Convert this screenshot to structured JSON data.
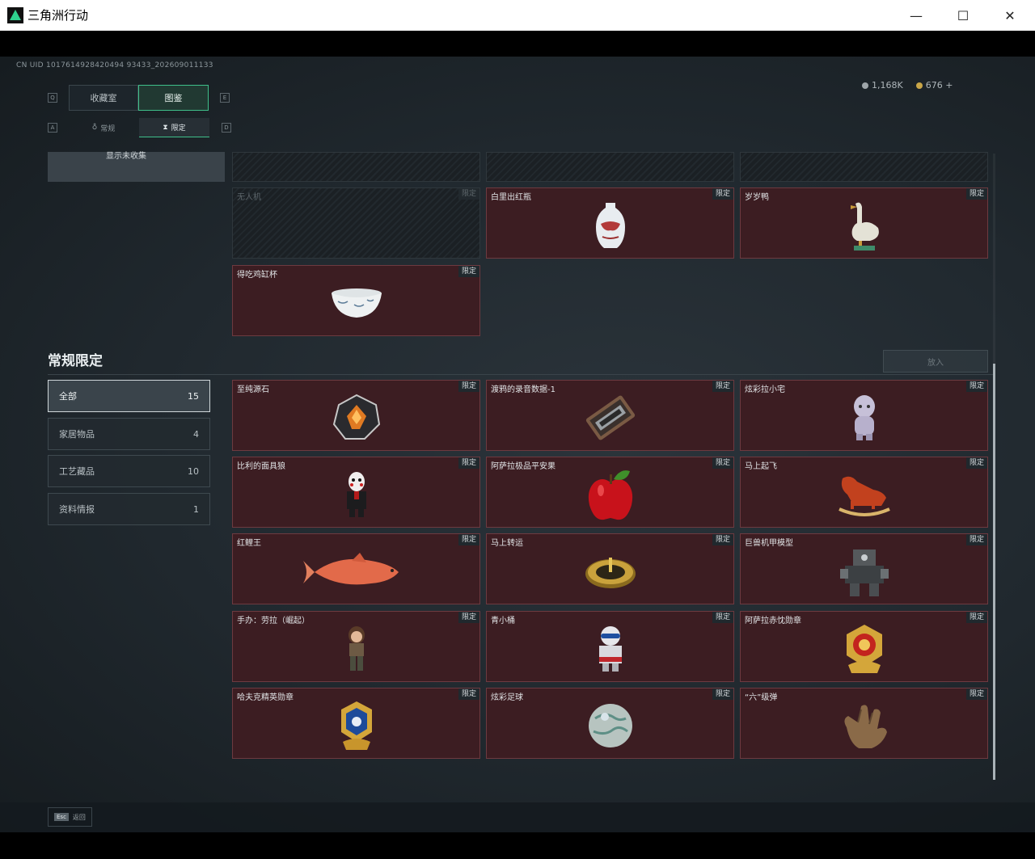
{
  "window": {
    "title": "三角洲行动",
    "minimize": "—",
    "maximize": "☐",
    "close": "✕"
  },
  "uid": "CN UID 1017614928420494 93433_202609011133",
  "currency": {
    "silver": "1,168K",
    "gold": "676",
    "add": "+"
  },
  "tabs": {
    "key_left": "Q",
    "key_right": "E",
    "items": [
      "收藏室",
      "图鉴"
    ]
  },
  "subtabs": {
    "key_left": "A",
    "key_right": "D",
    "items": [
      "常规",
      "限定"
    ]
  },
  "left_top_text": "显示未收集",
  "top_cards": [
    {
      "name": "无人机",
      "tag": "限定",
      "locked": true
    },
    {
      "name": "白里出红瓶",
      "tag": "限定",
      "locked": false
    },
    {
      "name": "岁岁鸭",
      "tag": "限定",
      "locked": false
    },
    {
      "name": "得吃鸡缸杯",
      "tag": "限定",
      "locked": false
    }
  ],
  "section": {
    "title": "常规限定",
    "put_in": "放入"
  },
  "categories": [
    {
      "name": "全部",
      "count": "15"
    },
    {
      "name": "家居物品",
      "count": "4"
    },
    {
      "name": "工艺藏品",
      "count": "10"
    },
    {
      "name": "资料情报",
      "count": "1"
    }
  ],
  "items": [
    {
      "name": "至纯源石",
      "tag": "限定"
    },
    {
      "name": "渡鸦的录音数据-1",
      "tag": "限定"
    },
    {
      "name": "炫彩拉小宅",
      "tag": "限定"
    },
    {
      "name": "比利的面具狼",
      "tag": "限定"
    },
    {
      "name": "阿萨拉极品平安果",
      "tag": "限定"
    },
    {
      "name": "马上起飞",
      "tag": "限定"
    },
    {
      "name": "红鲤王",
      "tag": "限定"
    },
    {
      "name": "马上转运",
      "tag": "限定"
    },
    {
      "name": "巨兽机甲模型",
      "tag": "限定"
    },
    {
      "name": "手办：劳拉（崛起）",
      "tag": "限定"
    },
    {
      "name": "青小桶",
      "tag": "限定"
    },
    {
      "name": "阿萨拉赤忱勋章",
      "tag": "限定"
    },
    {
      "name": "哈夫克精英勋章",
      "tag": "限定"
    },
    {
      "name": "炫彩足球",
      "tag": "限定"
    },
    {
      "name": "“六”级弹",
      "tag": "限定"
    }
  ],
  "footer": {
    "esc_key": "Esc",
    "back_label": "返回"
  },
  "colors": {
    "card_bg": "#3c1d22",
    "accent": "#3fbf8a"
  }
}
